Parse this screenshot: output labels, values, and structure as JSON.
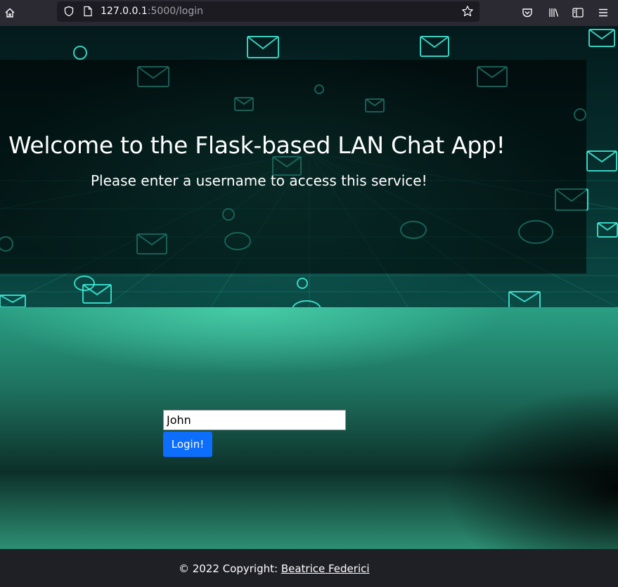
{
  "browser": {
    "url_host": "127.0.0.1",
    "url_path": ":5000/login",
    "icons": [
      "home-icon",
      "shield-icon",
      "page-icon",
      "bookmark-star-icon",
      "pocket-icon",
      "library-icon",
      "sidebar-icon",
      "menu-icon"
    ]
  },
  "hero": {
    "title": "Welcome to the Flask-based LAN Chat App!",
    "subtitle": "Please enter a username to access this service!"
  },
  "login": {
    "username_value": "John",
    "button_label": "Login!"
  },
  "footer": {
    "copyright": "© 2022 Copyright: ",
    "author": "Beatrice Federici"
  },
  "colors": {
    "accent": "#0d6efd",
    "toolbar": "#2b2a33",
    "footer": "#1f1f26",
    "teal": "#2a9f83"
  }
}
